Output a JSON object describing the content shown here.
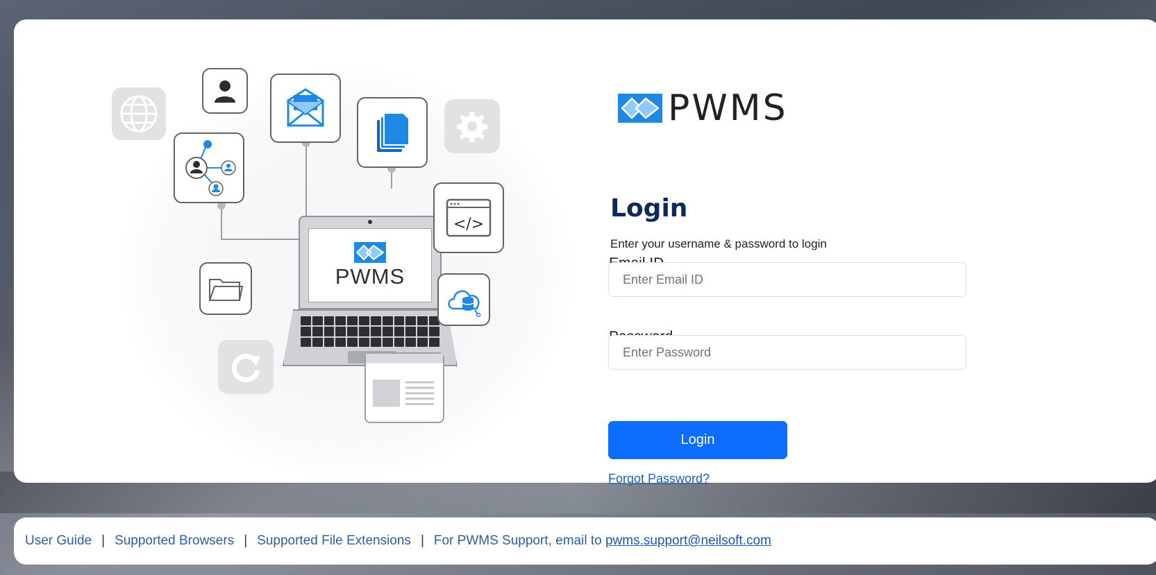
{
  "brand": {
    "name": "PWMS",
    "accent_color": "#1e88e5"
  },
  "illustration": {
    "screen_text": "PWMS",
    "icons": [
      "globe-icon",
      "user-icon",
      "email-icon",
      "documents-icon",
      "gear-icon",
      "user-network-icon",
      "code-icon",
      "folder-icon",
      "cloud-database-icon",
      "refresh-icon",
      "webpage-icon"
    ]
  },
  "login": {
    "title": "Login",
    "subtitle": "Enter your username & password to login",
    "email_label": "Email ID",
    "email_placeholder": "Enter Email ID",
    "email_value": "",
    "password_label": "Password",
    "password_placeholder": "Enter Password",
    "password_value": "",
    "button_label": "Login",
    "button_color": "#0d6efd",
    "forgot_label": "Forgot Password?"
  },
  "footer": {
    "links": [
      "User Guide",
      "Supported Browsers",
      "Supported File Extensions"
    ],
    "separator": "|",
    "support_text": "For PWMS Support, email to ",
    "support_email": "pwms.support@neilsoft.com"
  }
}
